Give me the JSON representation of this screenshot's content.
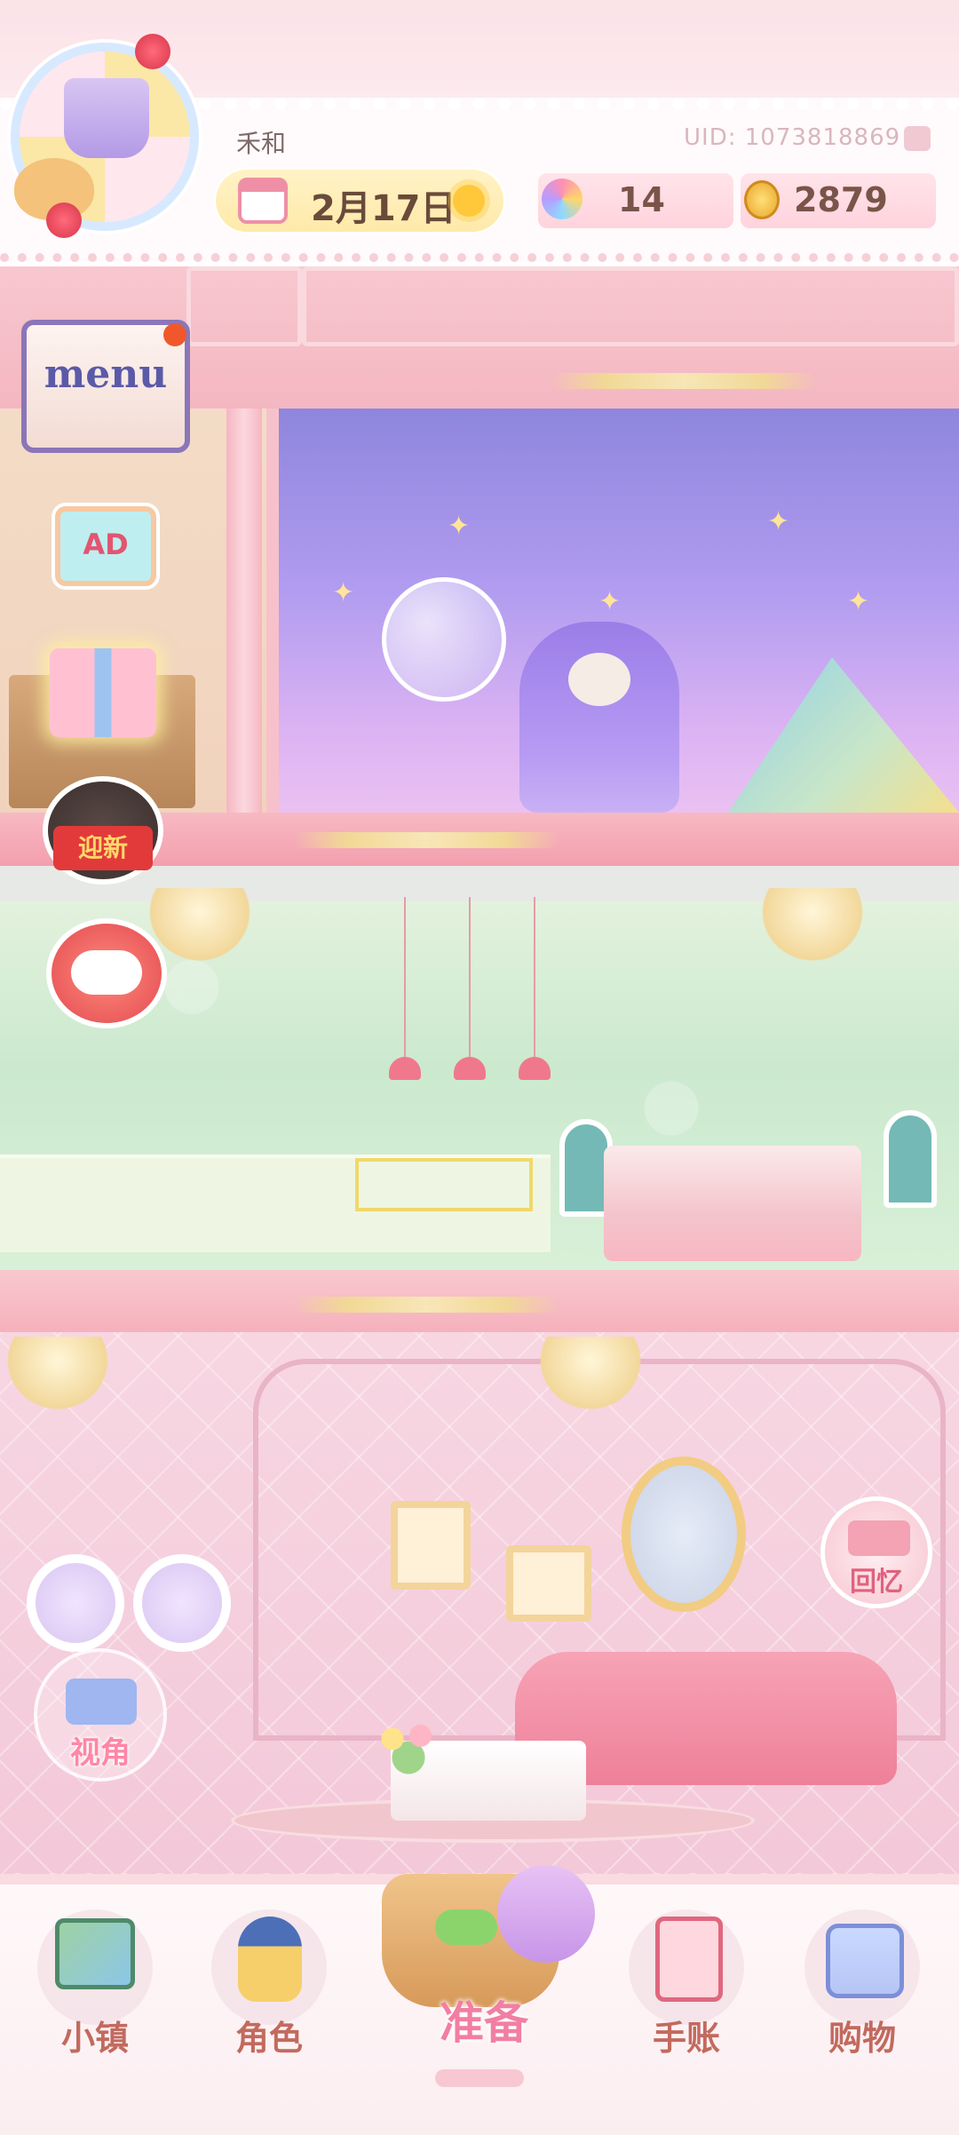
{
  "header": {
    "username": "禾和",
    "uid": "UID: 1073818869",
    "date": "2月17日",
    "stars": "14",
    "coins": "2879"
  },
  "side_buttons": {
    "menu": "menu",
    "ad": "AD",
    "new_year_tag": "迎新",
    "view": "视角",
    "memory": "回忆"
  },
  "bottom_nav": {
    "items": [
      {
        "label": "小镇",
        "icon": "map-icon"
      },
      {
        "label": "角色",
        "icon": "character-icon"
      },
      {
        "label": "准备",
        "icon": "basket-icon"
      },
      {
        "label": "手账",
        "icon": "journal-icon"
      },
      {
        "label": "购物",
        "icon": "shopping-bag-icon"
      }
    ],
    "active": "准备"
  },
  "colors": {
    "primary_pink": "#f6b6c2",
    "gold": "#f1d896",
    "text_brown": "#c26a5e",
    "accent_pink": "#f27ea3"
  }
}
